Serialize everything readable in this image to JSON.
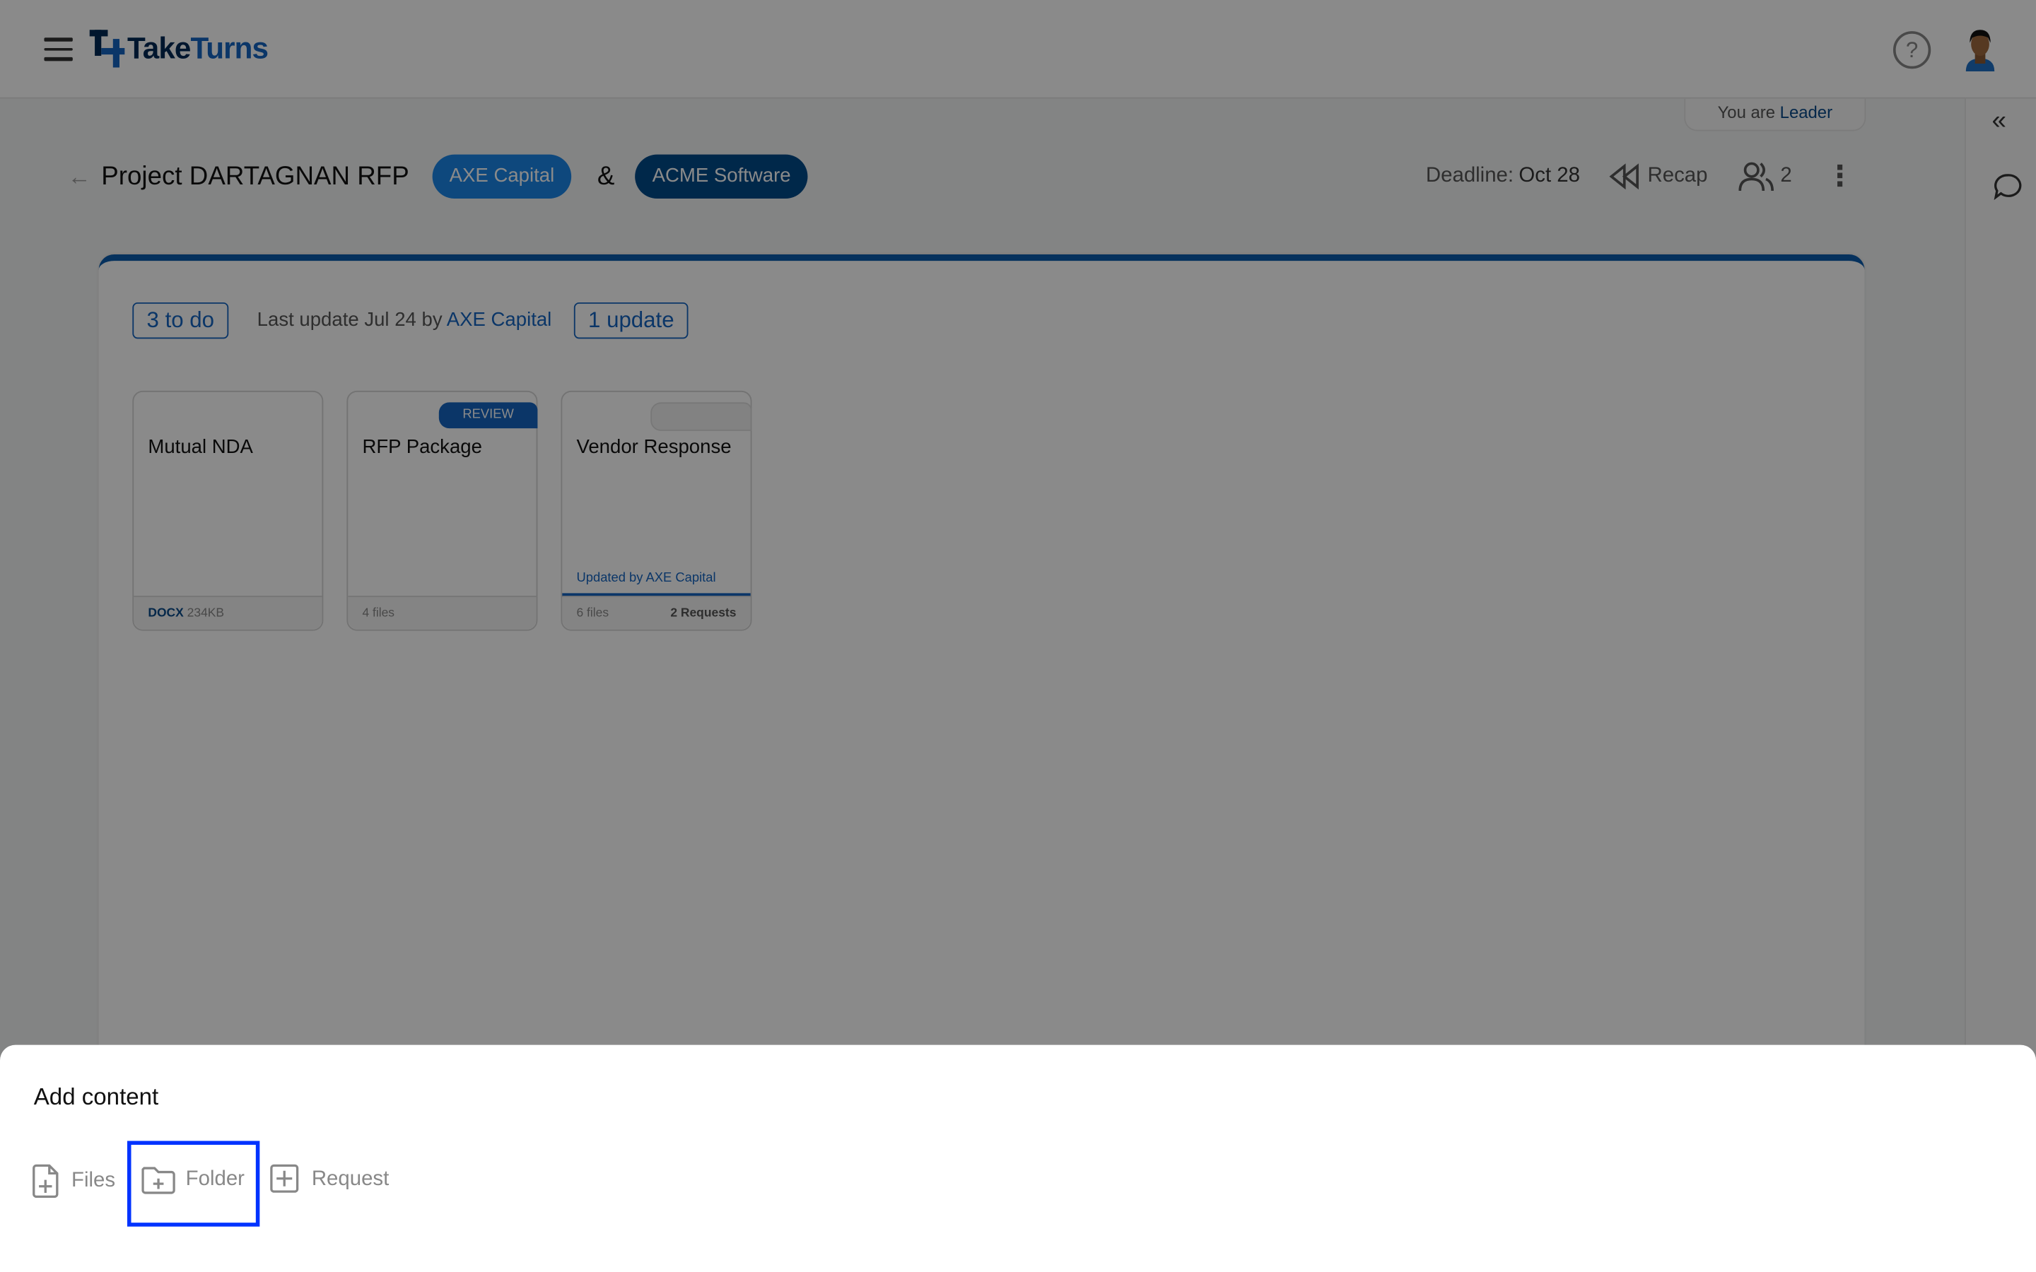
{
  "app": {
    "logo_text_dark": "Take",
    "logo_text_light": "Turns"
  },
  "header": {
    "help_icon": "question-circle-icon",
    "avatar": "user-avatar"
  },
  "role": {
    "prefix": "You are",
    "value": "Leader"
  },
  "project": {
    "title": "Project DARTAGNAN RFP",
    "party_a": "AXE Capital",
    "amp": "&",
    "party_b": "ACME Software",
    "deadline_label": "Deadline:",
    "deadline": "Oct 28",
    "recap": "Recap",
    "participants": "2"
  },
  "status": {
    "todo": "3 to do",
    "last_update_prefix": "Last update Jul 24 by",
    "last_update_by": "AXE Capital",
    "updates": "1 update"
  },
  "items": [
    {
      "name": "Mutual NDA",
      "type": "DOCX",
      "size": "234KB"
    },
    {
      "name": "RFP Package",
      "badge": "REVIEW",
      "files": "4 files"
    },
    {
      "name": "Vendor Response",
      "updated": "Updated by AXE Capital",
      "files": "6 files",
      "requests": "2 Requests"
    }
  ],
  "sheet": {
    "title": "Add content",
    "actions": [
      {
        "label": "Files"
      },
      {
        "label": "Folder"
      },
      {
        "label": "Request"
      }
    ]
  },
  "colors": {
    "brand": "#1565c0",
    "dark": "#004a8a",
    "highlight": "#0033ff"
  }
}
